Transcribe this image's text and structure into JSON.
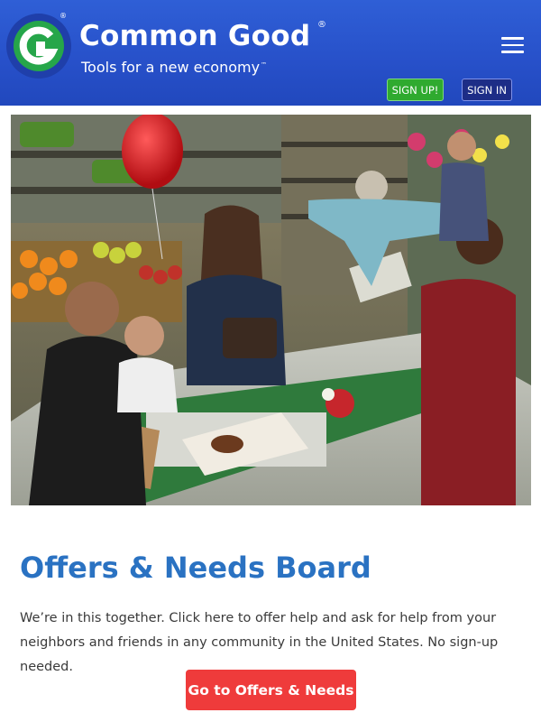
{
  "header": {
    "brand_name": "Common Good",
    "registered_mark": "®",
    "tagline": "Tools for a new economy",
    "tagline_mark": "™",
    "logo_letter": "G",
    "menu_icon": "hamburger-menu-icon",
    "signup_label": "SIGN UP!",
    "signin_label": "SIGN IN",
    "colors": {
      "bar": "#2750c9",
      "signup": "#2faa2f",
      "signin": "#1d2d87"
    }
  },
  "hero": {
    "icon": "grocery-checkout-photo"
  },
  "board": {
    "title": "Offers & Needs Board",
    "description": "We’re in this together. Click here to offer help and ask for help from your neighbors and friends in any community in the United States. No sign-up needed.",
    "cta_label": "Go to Offers & Needs",
    "colors": {
      "title": "#2a72c2",
      "cta": "#ef3b3b"
    }
  }
}
